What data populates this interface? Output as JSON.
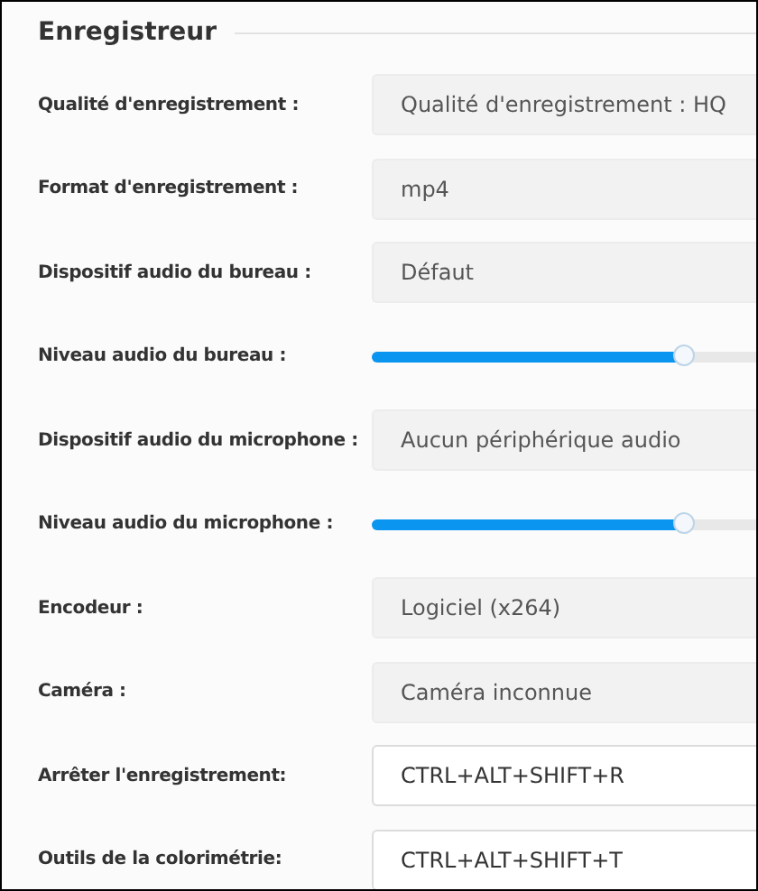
{
  "section": {
    "title": "Enregistreur"
  },
  "rows": [
    {
      "kind": "select",
      "label": "Qualité d'enregistrement :",
      "value": "Qualité d'enregistrement : HQ"
    },
    {
      "kind": "select",
      "label": "Format d'enregistrement :",
      "value": "mp4"
    },
    {
      "kind": "select",
      "label": "Dispositif audio du bureau :",
      "value": "Défaut"
    },
    {
      "kind": "slider",
      "label": "Niveau audio du bureau :",
      "level": 0.81
    },
    {
      "kind": "select",
      "label": "Dispositif audio du microphone :",
      "value": "Aucun périphérique audio"
    },
    {
      "kind": "slider",
      "label": "Niveau audio du microphone :",
      "level": 0.81
    },
    {
      "kind": "select",
      "label": "Encodeur :",
      "value": "Logiciel (x264)"
    },
    {
      "kind": "select",
      "label": "Caméra :",
      "value": "Caméra inconnue"
    },
    {
      "kind": "hotkey",
      "label": "Arrêter l'enregistrement:",
      "value": "CTRL+ALT+SHIFT+R"
    },
    {
      "kind": "hotkey",
      "label": "Outils de la colorimétrie:",
      "value": "CTRL+ALT+SHIFT+T"
    }
  ]
}
